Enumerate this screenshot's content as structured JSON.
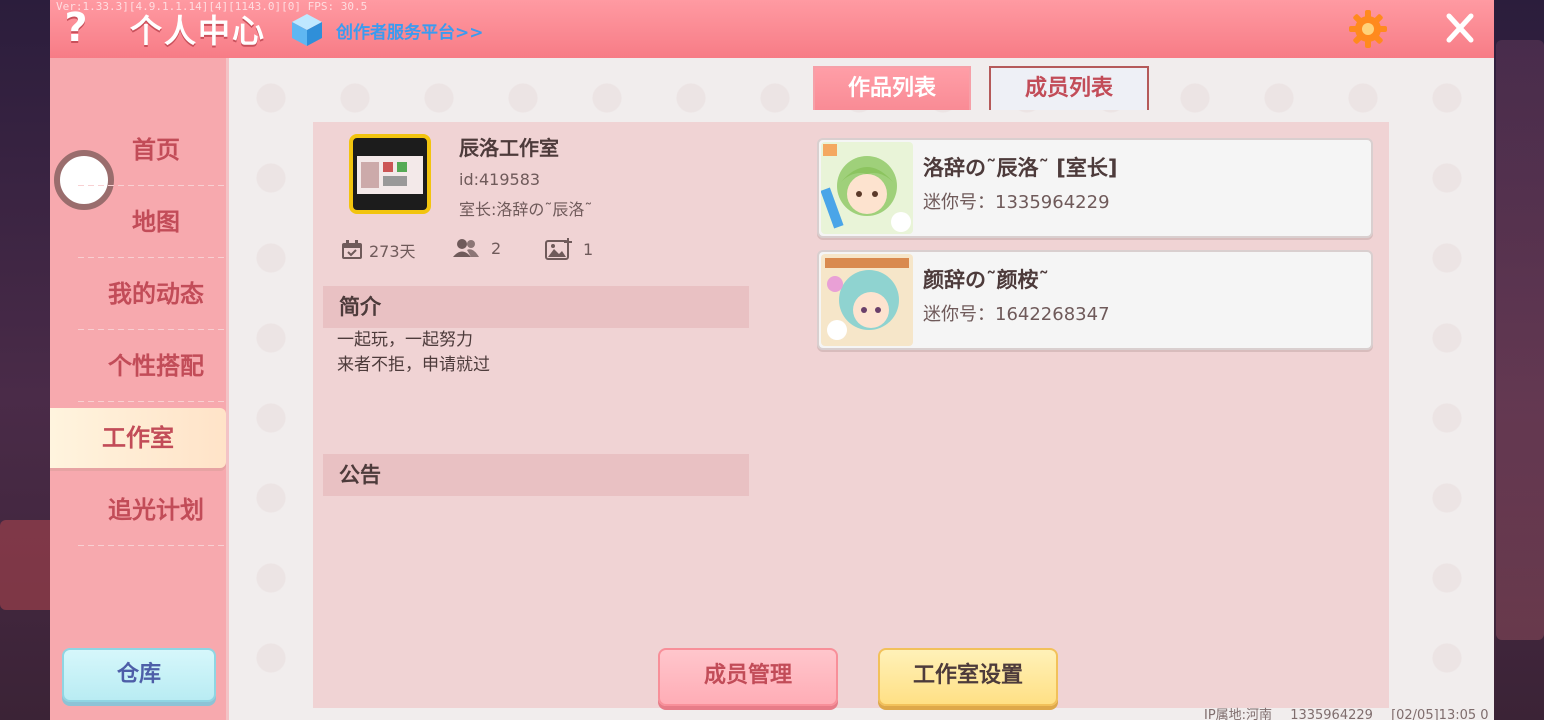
{
  "debug_overlay": "Ver:1.33.3][4.9.1.1.14][4][1143.0][0] FPS: 30.5",
  "header": {
    "title": "个人中心",
    "creator_link": "创作者服务平台>>",
    "help_icon": "question-mark-icon",
    "settings_icon": "gear-icon",
    "close_icon": "close-icon",
    "accent_color": "#f77c86"
  },
  "sidebar": {
    "items": [
      {
        "label": "首页"
      },
      {
        "label": "地图"
      },
      {
        "label": "我的动态"
      },
      {
        "label": "个性搭配"
      },
      {
        "label": "工作室",
        "active": true
      },
      {
        "label": "追光计划"
      }
    ],
    "warehouse_label": "仓库"
  },
  "tabs": {
    "works": "作品列表",
    "members": "成员列表",
    "active": "成员列表"
  },
  "studio": {
    "name": "辰洛工作室",
    "id": "id:419583",
    "owner": "室长:洛辞の˜辰洛˜",
    "days": "273天",
    "members_count": "2",
    "works_count": "1",
    "intro_title": "简介",
    "intro_lines": [
      "一起玩，一起努力",
      "来者不拒，申请就过"
    ],
    "notice_title": "公告"
  },
  "members": [
    {
      "name": "洛辞の˜辰洛˜ [室长]",
      "mini_no": "迷你号：1335964229"
    },
    {
      "name": "颜辞の˜颜桉˜",
      "mini_no": "迷你号：1642268347"
    }
  ],
  "actions": {
    "manage": "成员管理",
    "settings": "工作室设置"
  },
  "footer": {
    "ip": "IP属地:河南",
    "uid": "1335964229",
    "time": "[02/05]13:05 0"
  }
}
